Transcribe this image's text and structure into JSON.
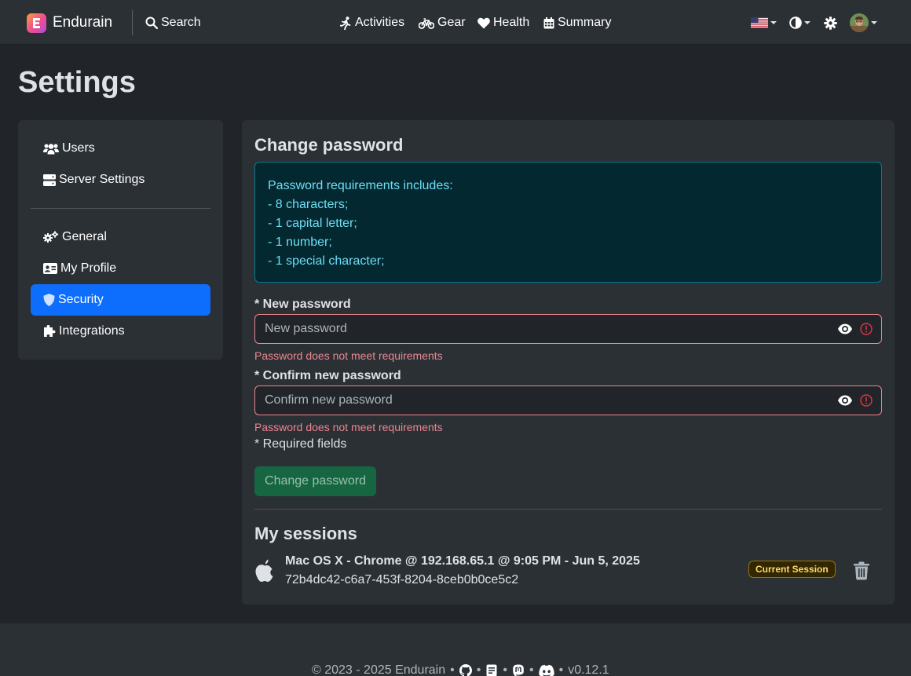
{
  "navbar": {
    "brand": "Endurain",
    "search_label": "Search",
    "links": [
      {
        "label": "Activities",
        "icon": "running-icon"
      },
      {
        "label": "Gear",
        "icon": "bicycle-icon"
      },
      {
        "label": "Health",
        "icon": "heart-icon"
      },
      {
        "label": "Summary",
        "icon": "calendar-icon"
      }
    ],
    "right_icons": [
      "us-flag-icon",
      "contrast-icon",
      "gear-icon",
      "user-avatar"
    ]
  },
  "page": {
    "title": "Settings"
  },
  "sidebar": {
    "items": [
      {
        "label": "Users",
        "icon": "users-icon",
        "active": false
      },
      {
        "label": "Server Settings",
        "icon": "server-icon",
        "active": false
      },
      {
        "label": "General",
        "icon": "gears-icon",
        "active": false
      },
      {
        "label": "My Profile",
        "icon": "id-card-icon",
        "active": false
      },
      {
        "label": "Security",
        "icon": "shield-icon",
        "active": true
      },
      {
        "label": "Integrations",
        "icon": "puzzle-icon",
        "active": false
      }
    ]
  },
  "change_password": {
    "title": "Change password",
    "requirements": [
      "Password requirements includes:",
      "- 8 characters;",
      "- 1 capital letter;",
      "- 1 number;",
      "- 1 special character;"
    ],
    "new_password": {
      "label": "* New password",
      "placeholder": "New password",
      "value": "",
      "error": "Password does not meet requirements"
    },
    "confirm_password": {
      "label": "* Confirm new password",
      "placeholder": "Confirm new password",
      "value": "",
      "error": "Password does not meet requirements"
    },
    "required_note": "* Required fields",
    "submit_label": "Change password"
  },
  "sessions": {
    "title": "My sessions",
    "items": [
      {
        "title": "Mac OS X - Chrome @ 192.168.65.1 @ 9:05 PM - Jun 5, 2025",
        "id": "72b4dc42-c6a7-453f-8204-8ceb0b0ce5c2",
        "badge": "Current Session",
        "os_icon": "apple-icon"
      }
    ]
  },
  "footer": {
    "copyright": "© 2023 - 2025 Endurain",
    "separator": "•",
    "version": "v0.12.1"
  },
  "colors": {
    "background": "#212529",
    "surface": "#2b3035",
    "primary": "#0d6efd",
    "danger": "#ea868f",
    "info_text": "#6edff6",
    "success": "#146c43",
    "warning_text": "#ffda6a"
  }
}
